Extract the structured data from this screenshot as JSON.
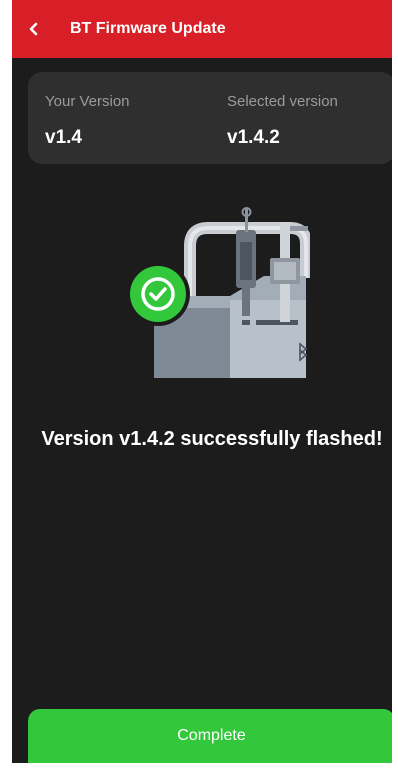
{
  "header": {
    "title": "BT Firmware Update",
    "back_icon": "chevron-left-icon",
    "color": "#d81e26"
  },
  "versions": {
    "current_label": "Your Version",
    "current_value": "v1.4",
    "selected_label": "Selected version",
    "selected_value": "v1.4.2"
  },
  "status": {
    "icon": "check-circle-icon",
    "illustration": "firmware-device-illustration",
    "message": "Version v1.4.2 successfully flashed!",
    "success_color": "#33c73b"
  },
  "footer": {
    "complete_label": "Complete"
  }
}
